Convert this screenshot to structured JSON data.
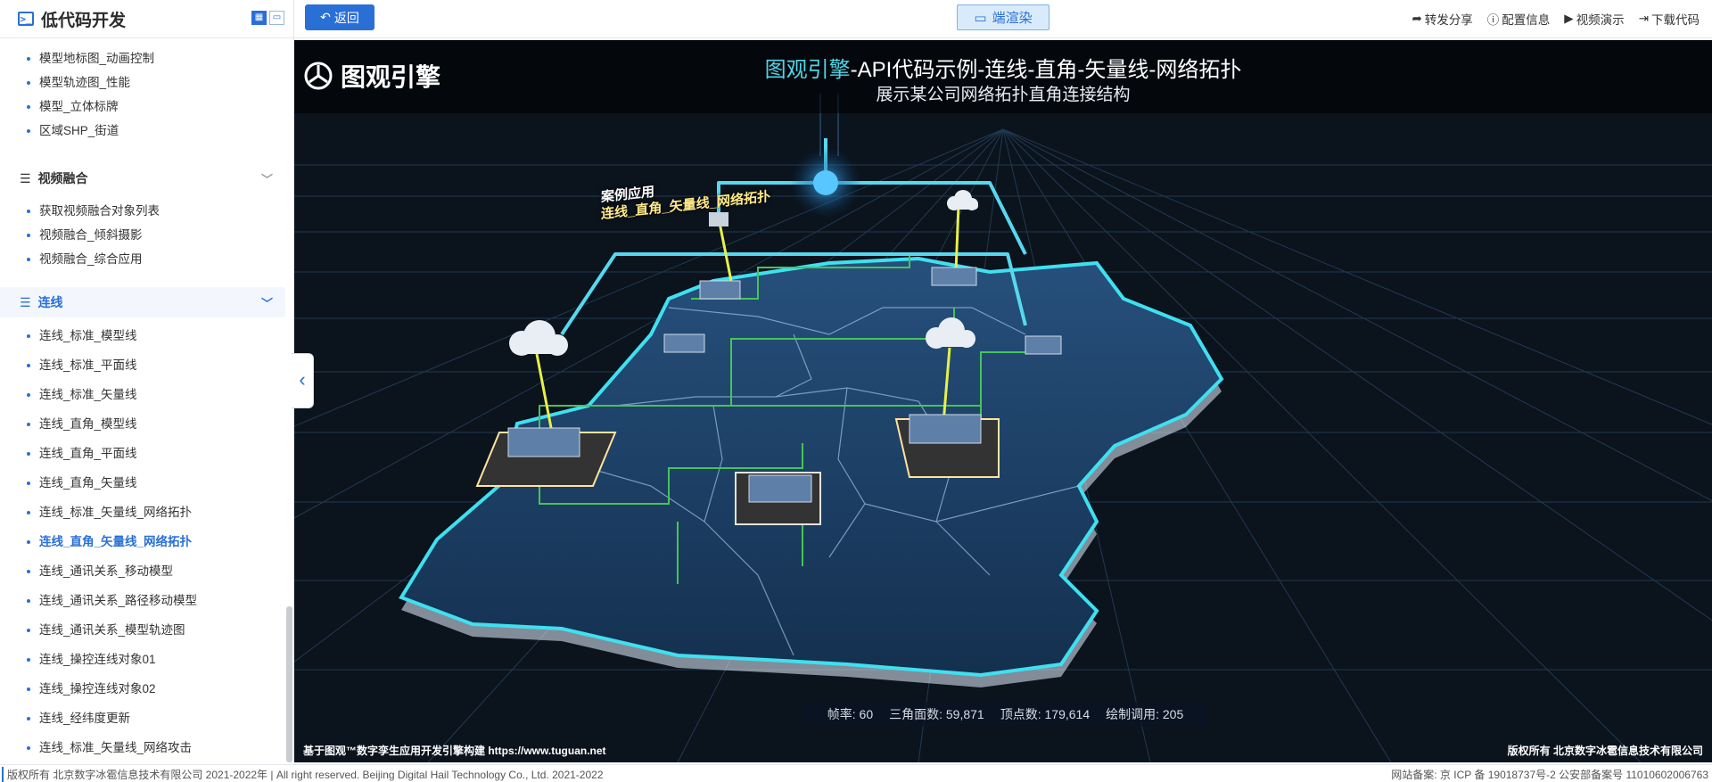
{
  "sidebar": {
    "title": "低代码开发",
    "items_top": [
      "模型地标图_动画控制",
      "模型轨迹图_性能",
      "模型_立体标牌",
      "区域SHP_街道"
    ],
    "group_video": "视频融合",
    "items_video": [
      "获取视频融合对象列表",
      "视频融合_倾斜摄影",
      "视频融合_综合应用"
    ],
    "group_lines": "连线",
    "items_lines": [
      "连线_标准_模型线",
      "连线_标准_平面线",
      "连线_标准_矢量线",
      "连线_直角_模型线",
      "连线_直角_平面线",
      "连线_直角_矢量线",
      "连线_标准_矢量线_网络拓扑",
      "连线_直角_矢量线_网络拓扑",
      "连线_通讯关系_移动模型",
      "连线_通讯关系_路径移动模型",
      "连线_通讯关系_模型轨迹图",
      "连线_操控连线对象01",
      "连线_操控连线对象02",
      "连线_经纬度更新",
      "连线_标准_矢量线_网络攻击"
    ],
    "active_item": "连线_直角_矢量线_网络拓扑"
  },
  "topbar": {
    "back_label": "返回",
    "render_label": "端渲染",
    "actions": [
      "转发分享",
      "配置信息",
      "视频演示",
      "下载代码"
    ]
  },
  "viewport": {
    "logo_text": "图观引擎",
    "title_accent": "图观引擎",
    "title_rest": "-API代码示例-连线-直角-矢量线-网络拓扑",
    "subtitle": "展示某公司网络拓扑直角连接结构",
    "floating_label_1": "案例应用",
    "floating_label_2": "连线_直角_矢量线_网络拓扑",
    "stats": {
      "fps": "帧率:  60",
      "triangles": "三角面数:  59,871",
      "vertices": "顶点数:  179,614",
      "draw_calls": "绘制调用:  205"
    },
    "footer_left": "基于图观™数字孪生应用开发引擎构建 https://www.tuguan.net",
    "footer_right": "版权所有 北京数字冰雹信息技术有限公司"
  },
  "footer": {
    "left": "版权所有 北京数字冰雹信息技术有限公司 2021-2022年 | All right reserved. Beijing Digital Hail Technology Co., Ltd. 2021-2022",
    "right": "网站备案: 京 ICP 备 19018737号-2 公安部备案号 11010602006763"
  },
  "colors": {
    "accent": "#2a6fd6",
    "scene_bg": "#0a121c",
    "map_fill": "#1d3f66",
    "map_edge": "#3fe0f0",
    "cyan_line": "#56d8ee",
    "yellow_line": "#e6f04a",
    "green_line": "#4cc95a",
    "grid": "#2b4a6a"
  }
}
